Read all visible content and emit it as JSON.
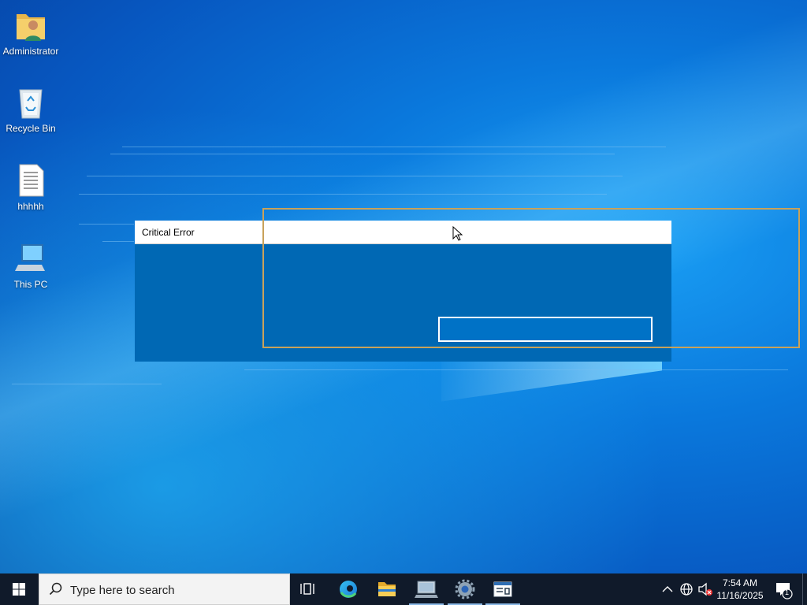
{
  "desktop": {
    "icons": [
      {
        "label": "Administrator",
        "icon": "user-folder-icon"
      },
      {
        "label": "Recycle Bin",
        "icon": "recycle-bin-icon"
      },
      {
        "label": "hhhhh",
        "icon": "text-file-icon"
      },
      {
        "label": "This PC",
        "icon": "computer-icon"
      }
    ]
  },
  "dialog": {
    "title": "Critical Error"
  },
  "taskbar": {
    "search_placeholder": "Type here to search",
    "apps": [
      {
        "name": "task-view",
        "icon": "task-view-icon"
      },
      {
        "name": "edge",
        "icon": "edge-icon"
      },
      {
        "name": "file-explorer",
        "icon": "folder-icon",
        "active": true
      },
      {
        "name": "network-app",
        "icon": "network-computer-icon",
        "active": true
      },
      {
        "name": "settings",
        "icon": "gear-icon",
        "active": true
      },
      {
        "name": "window-app",
        "icon": "window-app-icon",
        "active": true
      }
    ],
    "tray": {
      "time": "7:54 AM",
      "date": "11/16/2025",
      "notification_count": "1"
    }
  },
  "colors": {
    "dialog_body": "#0068b4",
    "selection_border": "#c9a25a",
    "taskbar": "#101a2a"
  }
}
